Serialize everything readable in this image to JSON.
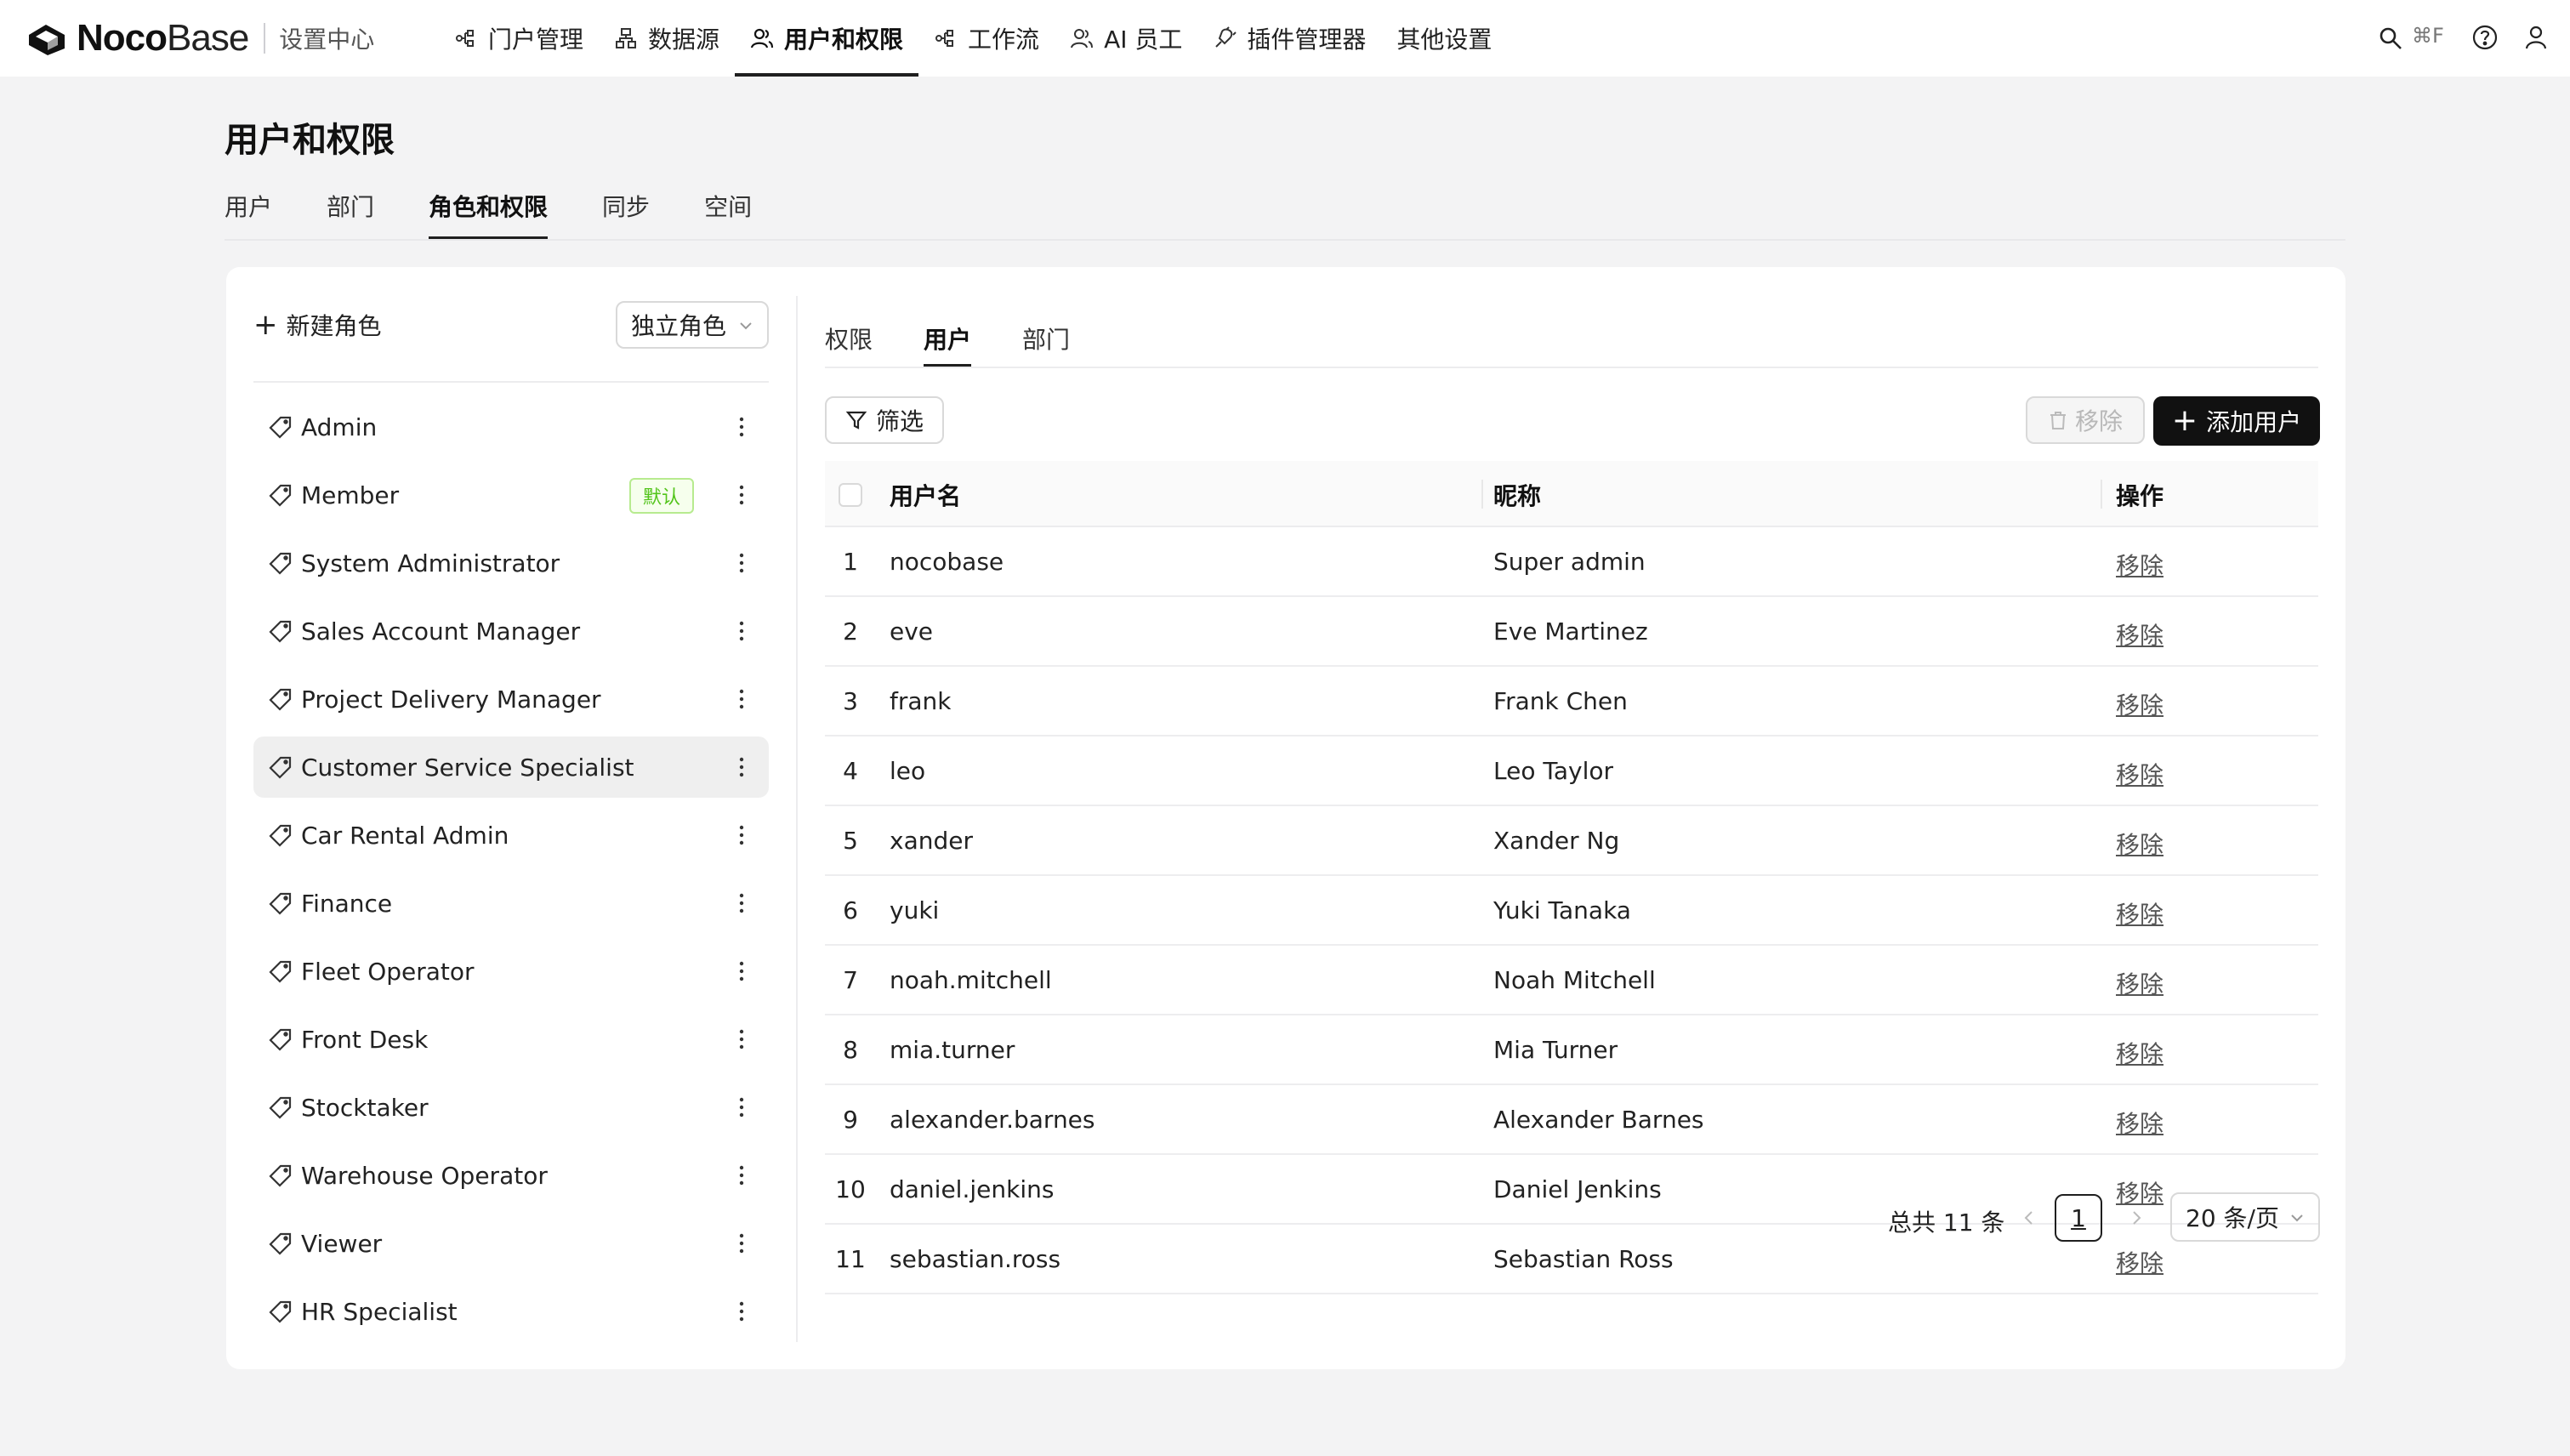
{
  "brand": {
    "name_bold": "Noco",
    "name_light": "Base",
    "subtitle": "设置中心"
  },
  "nav": {
    "items": [
      {
        "label": "门户管理",
        "icon": "portal-icon"
      },
      {
        "label": "数据源",
        "icon": "datasource-icon"
      },
      {
        "label": "用户和权限",
        "icon": "users-permissions-icon",
        "active": true
      },
      {
        "label": "工作流",
        "icon": "workflow-icon"
      },
      {
        "label": "AI 员工",
        "icon": "ai-employee-icon"
      },
      {
        "label": "插件管理器",
        "icon": "plugin-icon"
      },
      {
        "label": "其他设置",
        "icon": ""
      }
    ],
    "search_shortcut": "⌘F"
  },
  "page": {
    "title": "用户和权限",
    "tabs": [
      "用户",
      "部门",
      "角色和权限",
      "同步",
      "空间"
    ],
    "active_tab": "角色和权限"
  },
  "roles": {
    "new_role_label": "新建角色",
    "mode_select": "独立角色",
    "default_badge": "默认",
    "items": [
      {
        "name": "Admin"
      },
      {
        "name": "Member",
        "default": true
      },
      {
        "name": "System Administrator"
      },
      {
        "name": "Sales Account Manager"
      },
      {
        "name": "Project Delivery Manager"
      },
      {
        "name": "Customer Service Specialist",
        "selected": true
      },
      {
        "name": "Car Rental Admin"
      },
      {
        "name": "Finance"
      },
      {
        "name": "Fleet Operator"
      },
      {
        "name": "Front Desk"
      },
      {
        "name": "Stocktaker"
      },
      {
        "name": "Warehouse Operator"
      },
      {
        "name": "Viewer"
      },
      {
        "name": "HR Specialist"
      }
    ]
  },
  "detail": {
    "tabs": [
      "权限",
      "用户",
      "部门"
    ],
    "active_tab": "用户",
    "filter_label": "筛选",
    "remove_label": "移除",
    "add_user_label": "添加用户",
    "columns": {
      "username": "用户名",
      "nickname": "昵称",
      "actions": "操作"
    },
    "row_action": "移除",
    "rows": [
      {
        "index": "1",
        "username": "nocobase",
        "nickname": "Super admin"
      },
      {
        "index": "2",
        "username": "eve",
        "nickname": "Eve Martinez"
      },
      {
        "index": "3",
        "username": "frank",
        "nickname": "Frank Chen"
      },
      {
        "index": "4",
        "username": "leo",
        "nickname": "Leo Taylor"
      },
      {
        "index": "5",
        "username": "xander",
        "nickname": "Xander Ng"
      },
      {
        "index": "6",
        "username": "yuki",
        "nickname": "Yuki Tanaka"
      },
      {
        "index": "7",
        "username": "noah.mitchell",
        "nickname": "Noah Mitchell"
      },
      {
        "index": "8",
        "username": "mia.turner",
        "nickname": "Mia Turner"
      },
      {
        "index": "9",
        "username": "alexander.barnes",
        "nickname": "Alexander Barnes"
      },
      {
        "index": "10",
        "username": "daniel.jenkins",
        "nickname": "Daniel Jenkins"
      },
      {
        "index": "11",
        "username": "sebastian.ross",
        "nickname": "Sebastian Ross"
      }
    ],
    "pagination": {
      "total_text": "总共 11 条",
      "current_page": "1",
      "page_size": "20 条/页"
    }
  },
  "colors": {
    "primary": "#111111",
    "badge_green": "#52c41a",
    "badge_bg": "#f6ffed",
    "page_bg": "#f3f3f4"
  }
}
